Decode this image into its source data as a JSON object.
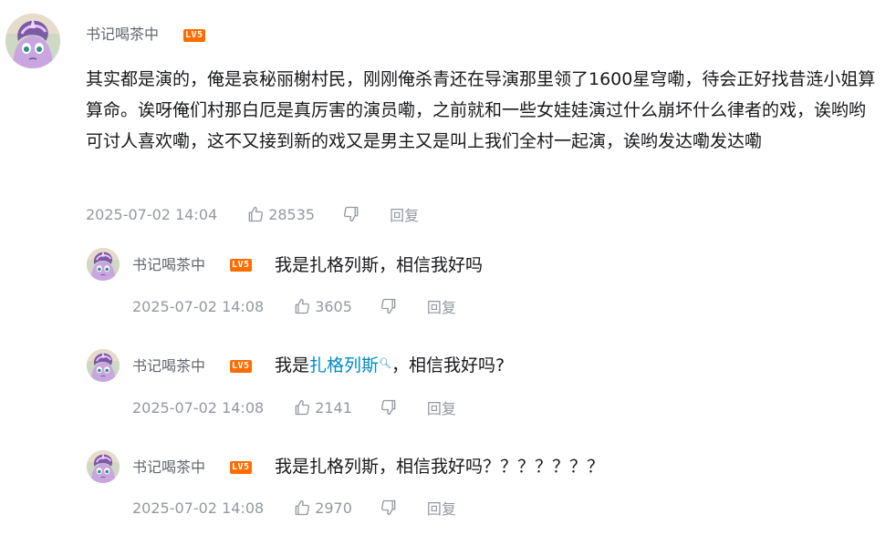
{
  "main_comment": {
    "username": "书记喝茶中",
    "level": "LV5",
    "text": "其实都是演的，俺是哀秘丽榭村民，刚刚俺杀青还在导演那里领了1600星穹嘞，待会正好找昔涟小姐算算命。诶呀俺们村那白厄是真厉害的演员嘞，之前就和一些女娃娃演过什么崩坏什么律者的戏，诶哟哟可讨人喜欢嘞，这不又接到新的戏又是男主又是叫上我们全村一起演，诶哟发达嘞发达嘞",
    "time": "2025-07-02 14:04",
    "likes": "28535",
    "reply_label": "回复"
  },
  "replies": [
    {
      "username": "书记喝茶中",
      "level": "LV5",
      "text_before": "我是扎格列斯，相信我好吗",
      "keyword": "",
      "text_after": "",
      "time": "2025-07-02 14:08",
      "likes": "3605",
      "reply_label": "回复"
    },
    {
      "username": "书记喝茶中",
      "level": "LV5",
      "text_before": "我是",
      "keyword": "扎格列斯",
      "text_after": "，相信我好吗?",
      "time": "2025-07-02 14:08",
      "likes": "2141",
      "reply_label": "回复"
    },
    {
      "username": "书记喝茶中",
      "level": "LV5",
      "text_before": "我是扎格列斯，相信我好吗？？？？？？？",
      "keyword": "",
      "text_after": "",
      "time": "2025-07-02 14:08",
      "likes": "2970",
      "reply_label": "回复"
    }
  ],
  "colors": {
    "level_badge": "#ff6d00",
    "link": "#008ac5",
    "meta_gray": "#9499a0"
  },
  "icons": {
    "like": "thumbs-up-icon",
    "dislike": "thumbs-down-icon",
    "search_hint": "search-icon"
  }
}
